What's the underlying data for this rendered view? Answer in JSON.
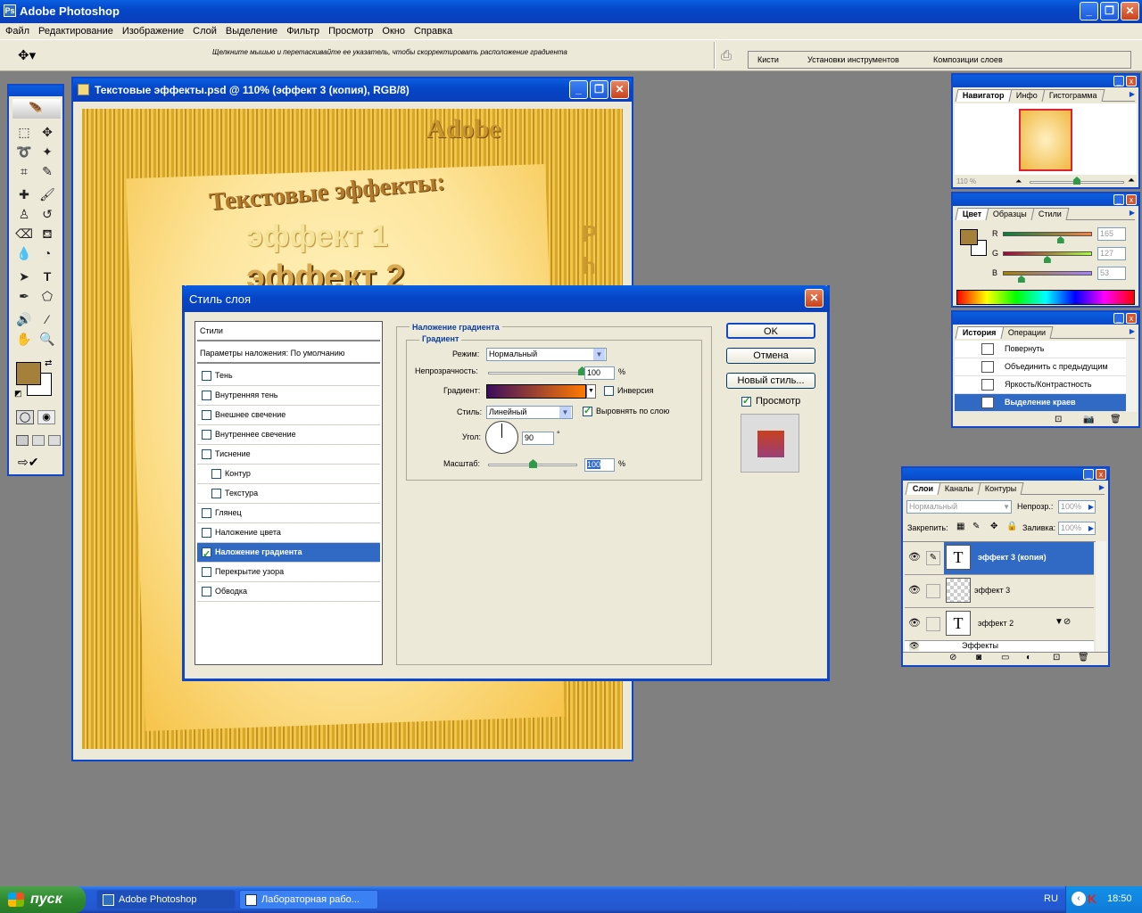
{
  "app_title": "Adobe Photoshop",
  "menu": [
    "Файл",
    "Редактирование",
    "Изображение",
    "Слой",
    "Выделение",
    "Фильтр",
    "Просмотр",
    "Окно",
    "Справка"
  ],
  "options_hint": "Щелкните мышью и перетаскивайте ее указатель, чтобы скорректировать расположение градиента",
  "palette_well_tabs": [
    "Кисти",
    "Установки инструментов",
    "Композиции слоев"
  ],
  "document": {
    "title": "Текстовые эффекты.psd @ 110% (эффект 3 (копия), RGB/8)",
    "canvas_texts": {
      "adobe": "Adobe",
      "heading": "Текстовые эффекты:",
      "effect1": "эффект 1",
      "effect2": "эффект 2",
      "ph": "Ph"
    }
  },
  "dialog": {
    "title": "Стиль слоя",
    "styles_header": "Стили",
    "blending_options": "Параметры наложения: По умолчанию",
    "styles": [
      {
        "label": "Тень",
        "checked": false,
        "indent": false,
        "selected": false
      },
      {
        "label": "Внутренняя тень",
        "checked": false,
        "indent": false,
        "selected": false
      },
      {
        "label": "Внешнее свечение",
        "checked": false,
        "indent": false,
        "selected": false
      },
      {
        "label": "Внутреннее свечение",
        "checked": false,
        "indent": false,
        "selected": false
      },
      {
        "label": "Тиснение",
        "checked": false,
        "indent": false,
        "selected": false
      },
      {
        "label": "Контур",
        "checked": false,
        "indent": true,
        "selected": false
      },
      {
        "label": "Текстура",
        "checked": false,
        "indent": true,
        "selected": false
      },
      {
        "label": "Глянец",
        "checked": false,
        "indent": false,
        "selected": false
      },
      {
        "label": "Наложение цвета",
        "checked": false,
        "indent": false,
        "selected": false
      },
      {
        "label": "Наложение градиента",
        "checked": true,
        "indent": false,
        "selected": true
      },
      {
        "label": "Перекрытие узора",
        "checked": false,
        "indent": false,
        "selected": false
      },
      {
        "label": "Обводка",
        "checked": false,
        "indent": false,
        "selected": false
      }
    ],
    "section_title": "Наложение градиента",
    "group_title": "Градиент",
    "mode_label": "Режим:",
    "mode_value": "Нормальный",
    "opacity_label": "Непрозрачность:",
    "opacity_value": "100",
    "opacity_fraction": 1.0,
    "percent": "%",
    "gradient_label": "Градиент:",
    "gradient_colors": [
      "#3b0d5e",
      "#ff7a00"
    ],
    "reverse_label": "Инверсия",
    "reverse_checked": false,
    "style_label": "Стиль:",
    "style_value": "Линейный",
    "align_label": "Выровнять по слою",
    "align_checked": true,
    "angle_label": "Угол:",
    "angle_value": "90",
    "degree": "°",
    "scale_label": "Масштаб:",
    "scale_value": "100",
    "scale_fraction": 0.5,
    "ok": "OK",
    "cancel": "Отмена",
    "new_style": "Новый стиль...",
    "preview_label": "Просмотр",
    "preview_checked": true,
    "preview_colors": [
      "#c8401e",
      "#9a3f7a"
    ]
  },
  "navigator": {
    "tabs": [
      "Навигатор",
      "Инфо",
      "Гистограмма"
    ],
    "zoom": "110 %",
    "zoom_fraction": 0.5
  },
  "color_panel": {
    "tabs": [
      "Цвет",
      "Образцы",
      "Стили"
    ],
    "fg": "#a5803b",
    "channels": [
      {
        "label": "R",
        "value": "165",
        "fraction": 0.647,
        "grad": [
          "#00803b",
          "#ff803b"
        ]
      },
      {
        "label": "G",
        "value": "127",
        "fraction": 0.498,
        "grad": [
          "#a5003b",
          "#a5ff3b"
        ]
      },
      {
        "label": "B",
        "value": "53",
        "fraction": 0.208,
        "grad": [
          "#a58000",
          "#a580ff"
        ]
      }
    ]
  },
  "history": {
    "tabs": [
      "История",
      "Операции"
    ],
    "items": [
      {
        "label": "Повернуть",
        "selected": false
      },
      {
        "label": "Объединить с предыдущим",
        "selected": false
      },
      {
        "label": "Яркость/Контрастность",
        "selected": false
      },
      {
        "label": "Выделение краев",
        "selected": true
      }
    ]
  },
  "layers": {
    "tabs": [
      "Слои",
      "Каналы",
      "Контуры"
    ],
    "blend_mode": "Нормальный",
    "opacity_label": "Непрозр.:",
    "opacity_value": "100%",
    "lock_label": "Закрепить:",
    "fill_label": "Заливка:",
    "fill_value": "100%",
    "items": [
      {
        "name": "эффект 3 (копия)",
        "type": "text",
        "selected": true
      },
      {
        "name": "эффект 3",
        "type": "raster",
        "selected": false
      },
      {
        "name": "эффект 2",
        "type": "text",
        "selected": false
      }
    ],
    "effects_label": "Эффекты"
  },
  "toolbox": {
    "fg_color": "#a5803b",
    "bg_color": "#ffffff"
  },
  "taskbar": {
    "start": "пуск",
    "tasks": [
      "Adobe Photoshop",
      "Лабораторная рабо..."
    ],
    "lang": "RU",
    "clock": "18:50"
  }
}
